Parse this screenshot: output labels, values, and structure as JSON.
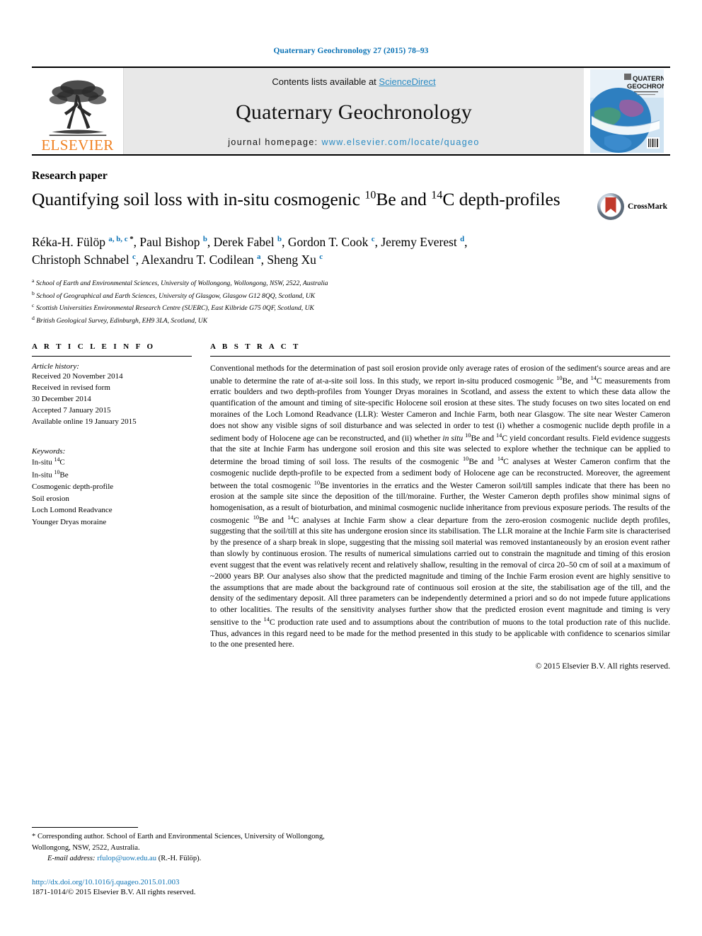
{
  "running_head": "Quaternary Geochronology 27 (2015) 78–93",
  "masthead": {
    "contents_prefix": "Contents lists available at ",
    "sciencedirect": "ScienceDirect",
    "journal_title": "Quaternary Geochronology",
    "homepage_label": "journal homepage: ",
    "homepage_url": "www.elsevier.com/locate/quageo",
    "publisher": "ELSEVIER",
    "cover_title_line1": "QUATERNARY",
    "cover_title_line2": "GEOCHRONOLOGY"
  },
  "article": {
    "type": "Research paper",
    "title_part1": "Quantifying soil loss with in-situ cosmogenic ",
    "title_sup1": "10",
    "title_part2": "Be and ",
    "title_sup2": "14",
    "title_part3": "C depth-profiles",
    "crossmark_label": "CrossMark"
  },
  "authors": {
    "line1": "Réka-H. Fülöp a, b, c, *, Paul Bishop b, Derek Fabel b, Gordon T. Cook c, Jeremy Everest d,",
    "line2": "Christoph Schnabel c, Alexandru T. Codilean a, Sheng Xu c"
  },
  "affiliations": [
    {
      "marker": "a",
      "text": "School of Earth and Environmental Sciences, University of Wollongong, Wollongong, NSW, 2522, Australia"
    },
    {
      "marker": "b",
      "text": "School of Geographical and Earth Sciences, University of Glasgow, Glasgow G12 8QQ, Scotland, UK"
    },
    {
      "marker": "c",
      "text": "Scottish Universities Environmental Research Centre (SUERC), East Kilbride G75 0QF, Scotland, UK"
    },
    {
      "marker": "d",
      "text": "British Geological Survey, Edinburgh, EH9 3LA, Scotland, UK"
    }
  ],
  "article_info": {
    "heading": "A R T I C L E   I N F O",
    "history_label": "Article history:",
    "history": [
      "Received 20 November 2014",
      "Received in revised form",
      "30 December 2014",
      "Accepted 7 January 2015",
      "Available online 19 January 2015"
    ],
    "keywords_label": "Keywords:",
    "keywords": [
      {
        "text": "In-situ ",
        "sup": "14",
        "tail": "C"
      },
      {
        "text": "In-situ ",
        "sup": "10",
        "tail": "Be"
      },
      {
        "text": "Cosmogenic depth-profile",
        "sup": "",
        "tail": ""
      },
      {
        "text": "Soil erosion",
        "sup": "",
        "tail": ""
      },
      {
        "text": "Loch Lomond Readvance",
        "sup": "",
        "tail": ""
      },
      {
        "text": "Younger Dryas moraine",
        "sup": "",
        "tail": ""
      }
    ]
  },
  "abstract": {
    "heading": "A B S T R A C T",
    "copyright": "© 2015 Elsevier B.V. All rights reserved."
  },
  "footer": {
    "corresponding": "* Corresponding author. School of Earth and Environmental Sciences, University of Wollongong, Wollongong, NSW, 2522, Australia.",
    "email_label": "E-mail address:",
    "email": "rfulop@uow.edu.au",
    "email_person": "(R.-H. Fülöp).",
    "doi": "http://dx.doi.org/10.1016/j.quageo.2015.01.003",
    "issn": "1871-1014/© 2015 Elsevier B.V. All rights reserved."
  },
  "colors": {
    "link_blue": "#0b72b5",
    "sciencedirect_blue": "#2a8bc4",
    "elsevier_orange": "#f08020",
    "masthead_grey": "#e8e8e8",
    "crossmark_red": "#c0392b"
  }
}
